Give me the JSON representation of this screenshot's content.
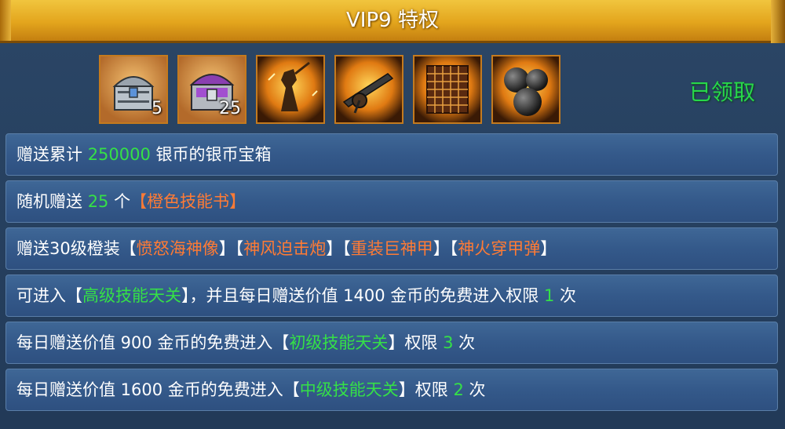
{
  "header": {
    "title": "VIP9 特权"
  },
  "rewards": {
    "items": [
      {
        "icon": "silver-chest-icon",
        "count": "5"
      },
      {
        "icon": "purple-chest-icon",
        "count": "25"
      },
      {
        "icon": "sea-god-statue-icon",
        "count": ""
      },
      {
        "icon": "mortar-cannon-icon",
        "count": ""
      },
      {
        "icon": "heavy-armor-icon",
        "count": ""
      },
      {
        "icon": "cannonball-icon",
        "count": ""
      }
    ],
    "status": "已领取"
  },
  "benefits": {
    "row1": {
      "a": "赠送累计 ",
      "b": "250000",
      "c": " 银币的银币宝箱"
    },
    "row2": {
      "a": "随机赠送 ",
      "b": "25",
      "c": " 个",
      "d": "【橙色技能书】"
    },
    "row3": {
      "a": "赠送30级橙装【",
      "b": "愤怒海神像",
      "c": "】【",
      "d": "神风迫击炮",
      "e": "】【",
      "f": "重装巨神甲",
      "g": "】【",
      "h": "神火穿甲弹",
      "i": "】"
    },
    "row4": {
      "a": "可进入【",
      "b": "高级技能天关",
      "c": "】，并且每日赠送价值 1400 金币的免费进入权限 ",
      "d": "1",
      "e": " 次"
    },
    "row5": {
      "a": "每日赠送价值 900 金币的免费进入【",
      "b": "初级技能天关",
      "c": "】权限 ",
      "d": "3",
      "e": " 次"
    },
    "row6": {
      "a": "每日赠送价值 1600 金币的免费进入【",
      "b": "中级技能天关",
      "c": "】权限 ",
      "d": "2",
      "e": " 次"
    }
  },
  "colors": {
    "highlight_green": "#35e047",
    "highlight_orange": "#ff7b35",
    "title_gold": "#e3a51d",
    "row_blue": "#34598a"
  }
}
